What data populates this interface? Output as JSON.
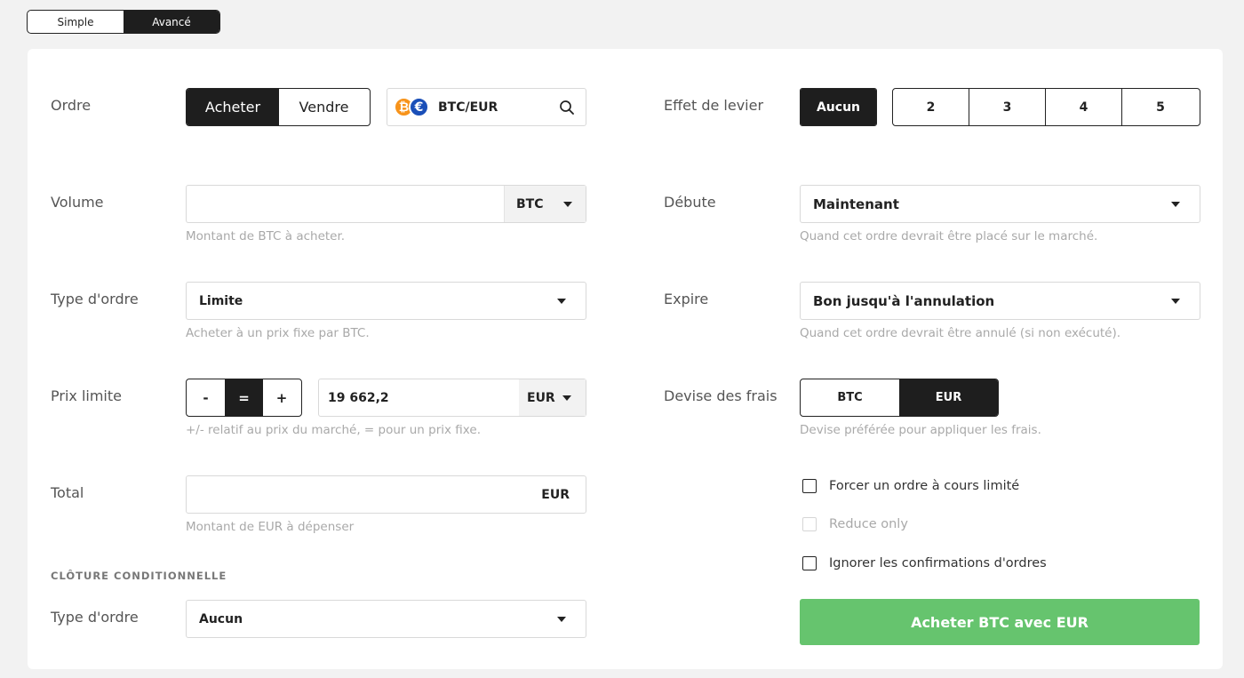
{
  "mode": {
    "simple": "Simple",
    "advanced": "Avancé",
    "active": "advanced"
  },
  "order": {
    "label": "Ordre",
    "buy": "Acheter",
    "sell": "Vendre",
    "pair": "BTC/EUR"
  },
  "volume": {
    "label": "Volume",
    "value": "",
    "currency": "BTC",
    "hint": "Montant de BTC à acheter."
  },
  "order_type": {
    "label": "Type d'ordre",
    "value": "Limite",
    "hint": "Acheter à un prix fixe par BTC."
  },
  "limit_price": {
    "label": "Prix limite",
    "minus": "-",
    "equal": "=",
    "plus": "+",
    "value": "19 662,2",
    "currency": "EUR",
    "hint": "+/- relatif au prix du marché, = pour un prix fixe."
  },
  "total": {
    "label": "Total",
    "value": "",
    "currency": "EUR",
    "hint": "Montant de EUR à dépenser"
  },
  "conditional_close": {
    "title": "CLÔTURE CONDITIONNELLE",
    "label": "Type d'ordre",
    "value": "Aucun"
  },
  "leverage": {
    "label": "Effet de levier",
    "none": "Aucun",
    "options": [
      "2",
      "3",
      "4",
      "5"
    ]
  },
  "starts": {
    "label": "Débute",
    "value": "Maintenant",
    "hint": "Quand cet ordre devrait être placé sur le marché."
  },
  "expires": {
    "label": "Expire",
    "value": "Bon jusqu'à l'annulation",
    "hint": "Quand cet ordre devrait être annulé (si non exécuté)."
  },
  "fee_currency": {
    "label": "Devise des frais",
    "btc": "BTC",
    "eur": "EUR",
    "hint": "Devise préférée pour appliquer les frais."
  },
  "options": {
    "post_only": "Forcer un ordre à cours limité",
    "reduce_only": "Reduce only",
    "ignore_confirm": "Ignorer les confirmations d'ordres"
  },
  "submit_label": "Acheter BTC avec EUR",
  "colors": {
    "submit": "#66c46e",
    "btc": "#f7931a",
    "eur": "#1a4fb8",
    "active": "#1e1e1e"
  },
  "icons": {
    "btc": "bitcoin-icon",
    "eur": "euro-icon",
    "search": "search-icon",
    "caret": "caret-down-icon"
  }
}
